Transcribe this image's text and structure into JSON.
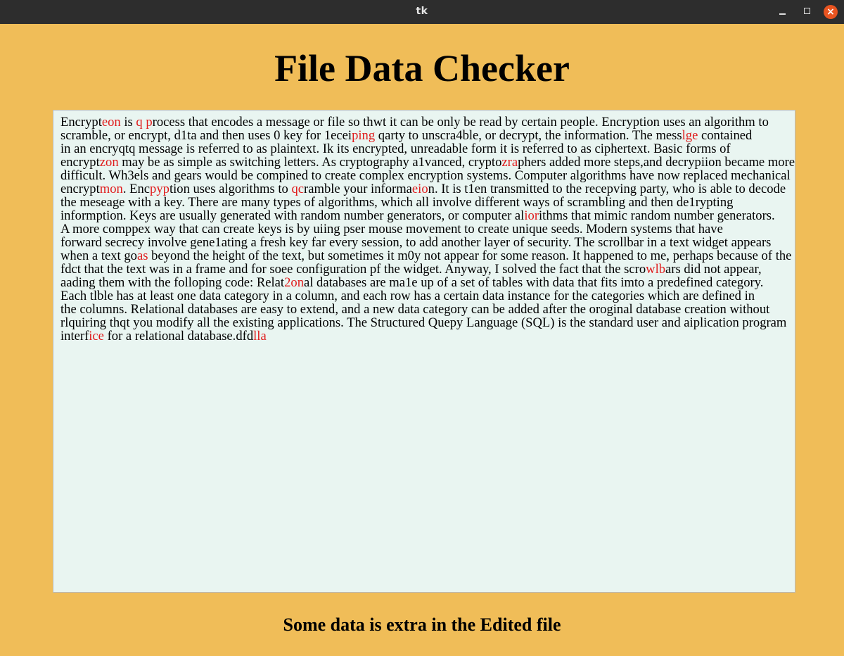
{
  "window": {
    "title": "tk"
  },
  "heading": "File Data Checker",
  "status_text": "Some data is extra in the Edited file",
  "colors": {
    "background": "#f0bd58",
    "textbox": "#e9f5f1",
    "highlight": "#e01b1b"
  },
  "text_lines": [
    [
      [
        "Encrypt",
        false
      ],
      [
        "eon",
        true
      ],
      [
        " is ",
        false
      ],
      [
        "q p",
        true
      ],
      [
        "rocess that encodes a message or file so thwt it can be only be read by certain people. Encryption uses an algorithm to",
        false
      ]
    ],
    [
      [
        "scramble, or encrypt, d1ta and then uses 0 key for 1ecei",
        false
      ],
      [
        "ping",
        true
      ],
      [
        " qarty to unscra4ble, or decrypt, the information. The mess",
        false
      ],
      [
        "lge",
        true
      ],
      [
        " contained",
        false
      ]
    ],
    [
      [
        "in an encryqtq message is referred to as plaintext. Ik its encrypted, unreadable form it is referred to as ciphertext. Basic forms of",
        false
      ]
    ],
    [
      [
        "encrypt",
        false
      ],
      [
        "zon",
        true
      ],
      [
        " may be as simple as switching letters. As cryptography a1vanced, crypto",
        false
      ],
      [
        "zra",
        true
      ],
      [
        "phers added more steps,and decrypiion became more",
        false
      ]
    ],
    [
      [
        "difficult. Wh3els and gears would be compined to create complex encryption systems. Computer algorithms have now replaced mechanical",
        false
      ]
    ],
    [
      [
        "encrypt",
        false
      ],
      [
        "mon",
        true
      ],
      [
        ". Enc",
        false
      ],
      [
        "pyp",
        true
      ],
      [
        "tion uses algorithms to ",
        false
      ],
      [
        "qc",
        true
      ],
      [
        "ramble your informa",
        false
      ],
      [
        "eio",
        true
      ],
      [
        "n. It is t1en transmitted to the recepving party, who is able to decode",
        false
      ]
    ],
    [
      [
        "the meseage with a key. There are many types of algorithms, which all involve different ways of scrambling and then de1rypting",
        false
      ]
    ],
    [
      [
        "informption. Keys are usually generated with random number generators, or computer al",
        false
      ],
      [
        "ior",
        true
      ],
      [
        "ithms that mimic random number generators.",
        false
      ]
    ],
    [
      [
        "A more comppex way that can create keys is by uiing pser mouse movement to create unique seeds. Modern systems that have",
        false
      ]
    ],
    [
      [
        "forward secrecy involve gene1ating a fresh key far every session, to add another layer of security. The scrollbar in a text widget appears",
        false
      ]
    ],
    [
      [
        "when a text go",
        false
      ],
      [
        "as",
        true
      ],
      [
        " beyond the height of the text, but sometimes it m0y not appear for some reason. It happened to me, perhaps because of the",
        false
      ]
    ],
    [
      [
        "fdct that the text was in a frame and for soee configuration pf the widget. Anyway, I solved the fact that the scro",
        false
      ],
      [
        "wlb",
        true
      ],
      [
        "ars did not appear,",
        false
      ]
    ],
    [
      [
        "aading them with the folloping code: Relat",
        false
      ],
      [
        "2on",
        true
      ],
      [
        "al databases are ma1e up of a set of tables with data that fits imto a predefined category.",
        false
      ]
    ],
    [
      [
        "Each tlble has at least one data category in a column, and each row has a certain data instance for the categories which are defined in",
        false
      ]
    ],
    [
      [
        "the columns. Relational databases are easy to extend, and a new data category can be added after the oroginal database creation without",
        false
      ]
    ],
    [
      [
        "rlquiring thqt you modify all the existing applications. The Structured Quepy Language (SQL) is the standard user and aiplication program",
        false
      ]
    ],
    [
      [
        "interf",
        false
      ],
      [
        "ice",
        true
      ],
      [
        " for a relational database.dfd",
        false
      ],
      [
        "lla",
        true
      ]
    ]
  ]
}
